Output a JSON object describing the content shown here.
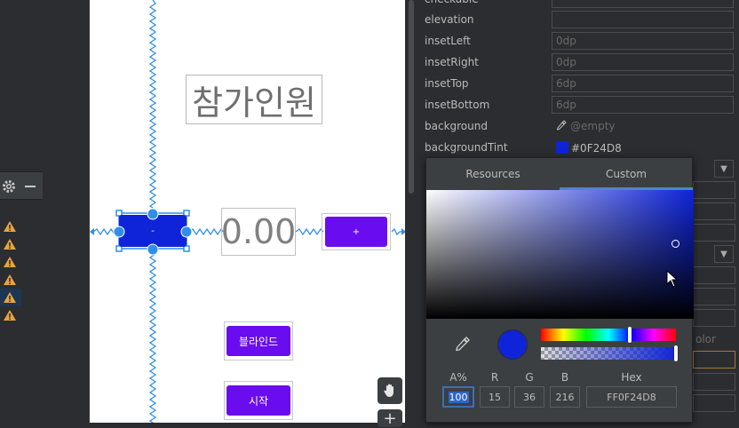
{
  "canvas": {
    "title": "참가인원",
    "minus_label": "-",
    "count_value": "0.00",
    "plus_label": "+",
    "blind_label": "블라인드",
    "start_label": "시작"
  },
  "attributes": [
    {
      "name": "checkable",
      "value": "",
      "placeholder": true
    },
    {
      "name": "elevation",
      "value": "",
      "placeholder": true
    },
    {
      "name": "insetLeft",
      "value": "0dp",
      "placeholder": true
    },
    {
      "name": "insetRight",
      "value": "0dp",
      "placeholder": true
    },
    {
      "name": "insetTop",
      "value": "6dp",
      "placeholder": true
    },
    {
      "name": "insetBottom",
      "value": "6dp",
      "placeholder": true
    },
    {
      "name": "background",
      "value": "@empty",
      "placeholder": true
    },
    {
      "name": "backgroundTint",
      "value": "#0F24D8",
      "placeholder": false
    }
  ],
  "partial_right_text": "olor",
  "color_picker": {
    "tabs": [
      "Resources",
      "Custom"
    ],
    "active_tab": "Custom",
    "color_hex": "#0F24D8",
    "labels": {
      "alpha": "A%",
      "r": "R",
      "g": "G",
      "b": "B",
      "hex": "Hex"
    },
    "values": {
      "alpha": "100",
      "r": "15",
      "g": "36",
      "b": "216",
      "hex": "FF0F24D8"
    }
  },
  "warnings_count": 6,
  "colors": {
    "button_blue": "#0f24d8",
    "button_purple": "#6a0cf0",
    "constraint": "#2f8fe8"
  }
}
